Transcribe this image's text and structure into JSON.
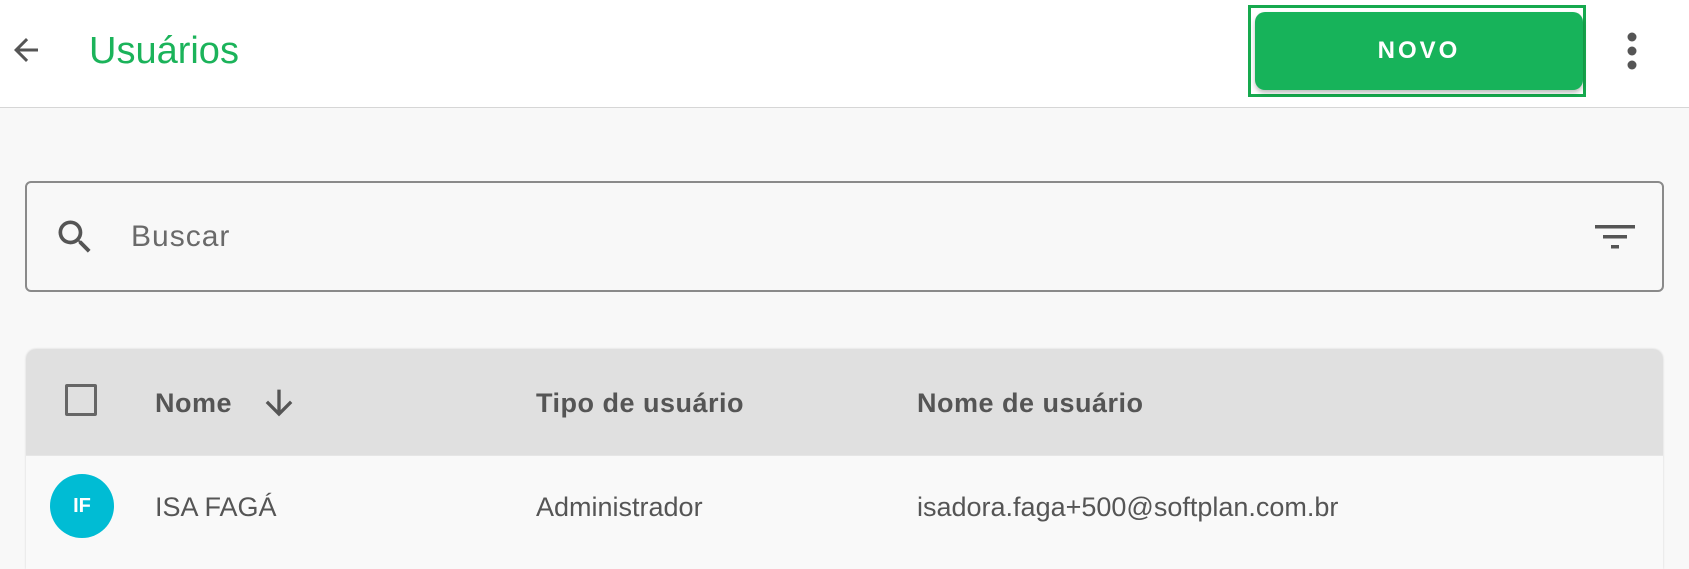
{
  "header": {
    "title": "Usuários",
    "new_button_label": "NOVO",
    "colors": {
      "title": "#1bb35a",
      "button": "#17b35a"
    }
  },
  "search": {
    "placeholder": "Buscar"
  },
  "table": {
    "columns": {
      "name": "Nome",
      "user_type": "Tipo de usuário",
      "username": "Nome de usuário"
    },
    "sort": {
      "column": "name",
      "direction": "descending"
    },
    "rows": [
      {
        "initials": "IF",
        "avatar_color": "#00bcd4",
        "name": "ISA FAGÁ",
        "user_type": "Administrador",
        "username": "isadora.faga+500@softplan.com.br"
      }
    ]
  },
  "icons": {
    "back": "arrow-left-icon",
    "more": "more-vertical-icon",
    "search": "search-icon",
    "filter": "filter-icon",
    "sort": "arrow-down-icon"
  }
}
